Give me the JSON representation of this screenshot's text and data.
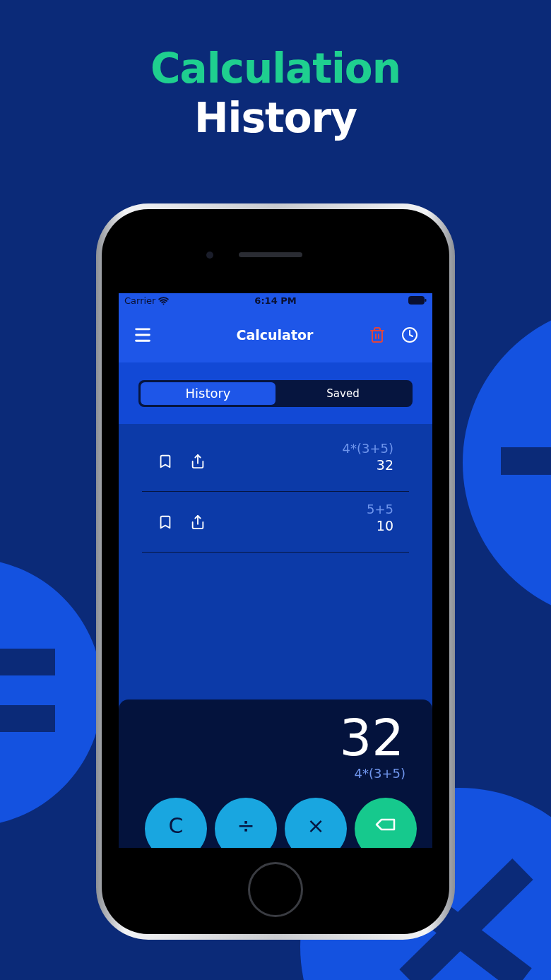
{
  "headline": {
    "line_1": "Calculation",
    "line_2": "History"
  },
  "status_bar": {
    "carrier": "Carrier",
    "time": "6:14 PM"
  },
  "nav_bar": {
    "title": "Calculator"
  },
  "tabs": [
    {
      "label": "History",
      "selected": true
    },
    {
      "label": "Saved",
      "selected": false
    }
  ],
  "history": [
    {
      "expression": "4*(3+5)",
      "result": "32"
    },
    {
      "expression": "5+5",
      "result": "10"
    }
  ],
  "display": {
    "result": "32",
    "expression": "4*(3+5)"
  },
  "keys": [
    {
      "kind": "text",
      "label": "C"
    },
    {
      "kind": "text",
      "label": "÷"
    },
    {
      "kind": "text",
      "label": "×"
    },
    {
      "kind": "backspace"
    }
  ]
}
